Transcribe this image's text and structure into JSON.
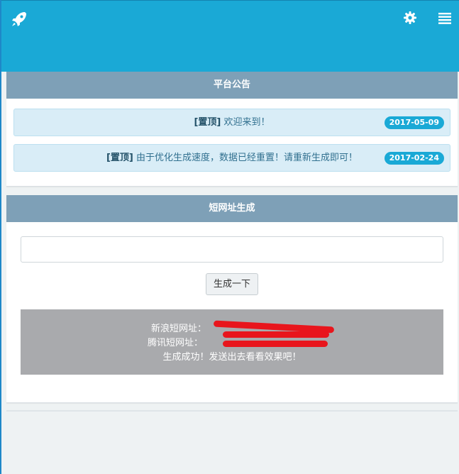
{
  "topbar": {
    "logo_icon": "rocket-icon",
    "settings_icon": "gear-icon",
    "menu_icon": "menu-icon",
    "color": "#1aa9d6"
  },
  "announcements": {
    "title": "平台公告",
    "items": [
      {
        "tag": "[置顶]",
        "text": "欢迎来到！",
        "date": "2017-05-09"
      },
      {
        "tag": "[置顶]",
        "text": "由于优化生成速度，数据已经重置！请重新生成即可！",
        "date": "2017-02-24"
      }
    ]
  },
  "shortener": {
    "title": "短网址生成",
    "input_value": "",
    "button_label": "生成一下",
    "result": {
      "sina_label": "新浪短网址：",
      "tencent_label": "腾讯短网址：",
      "message": "生成成功！发送出去看看效果吧！"
    }
  }
}
